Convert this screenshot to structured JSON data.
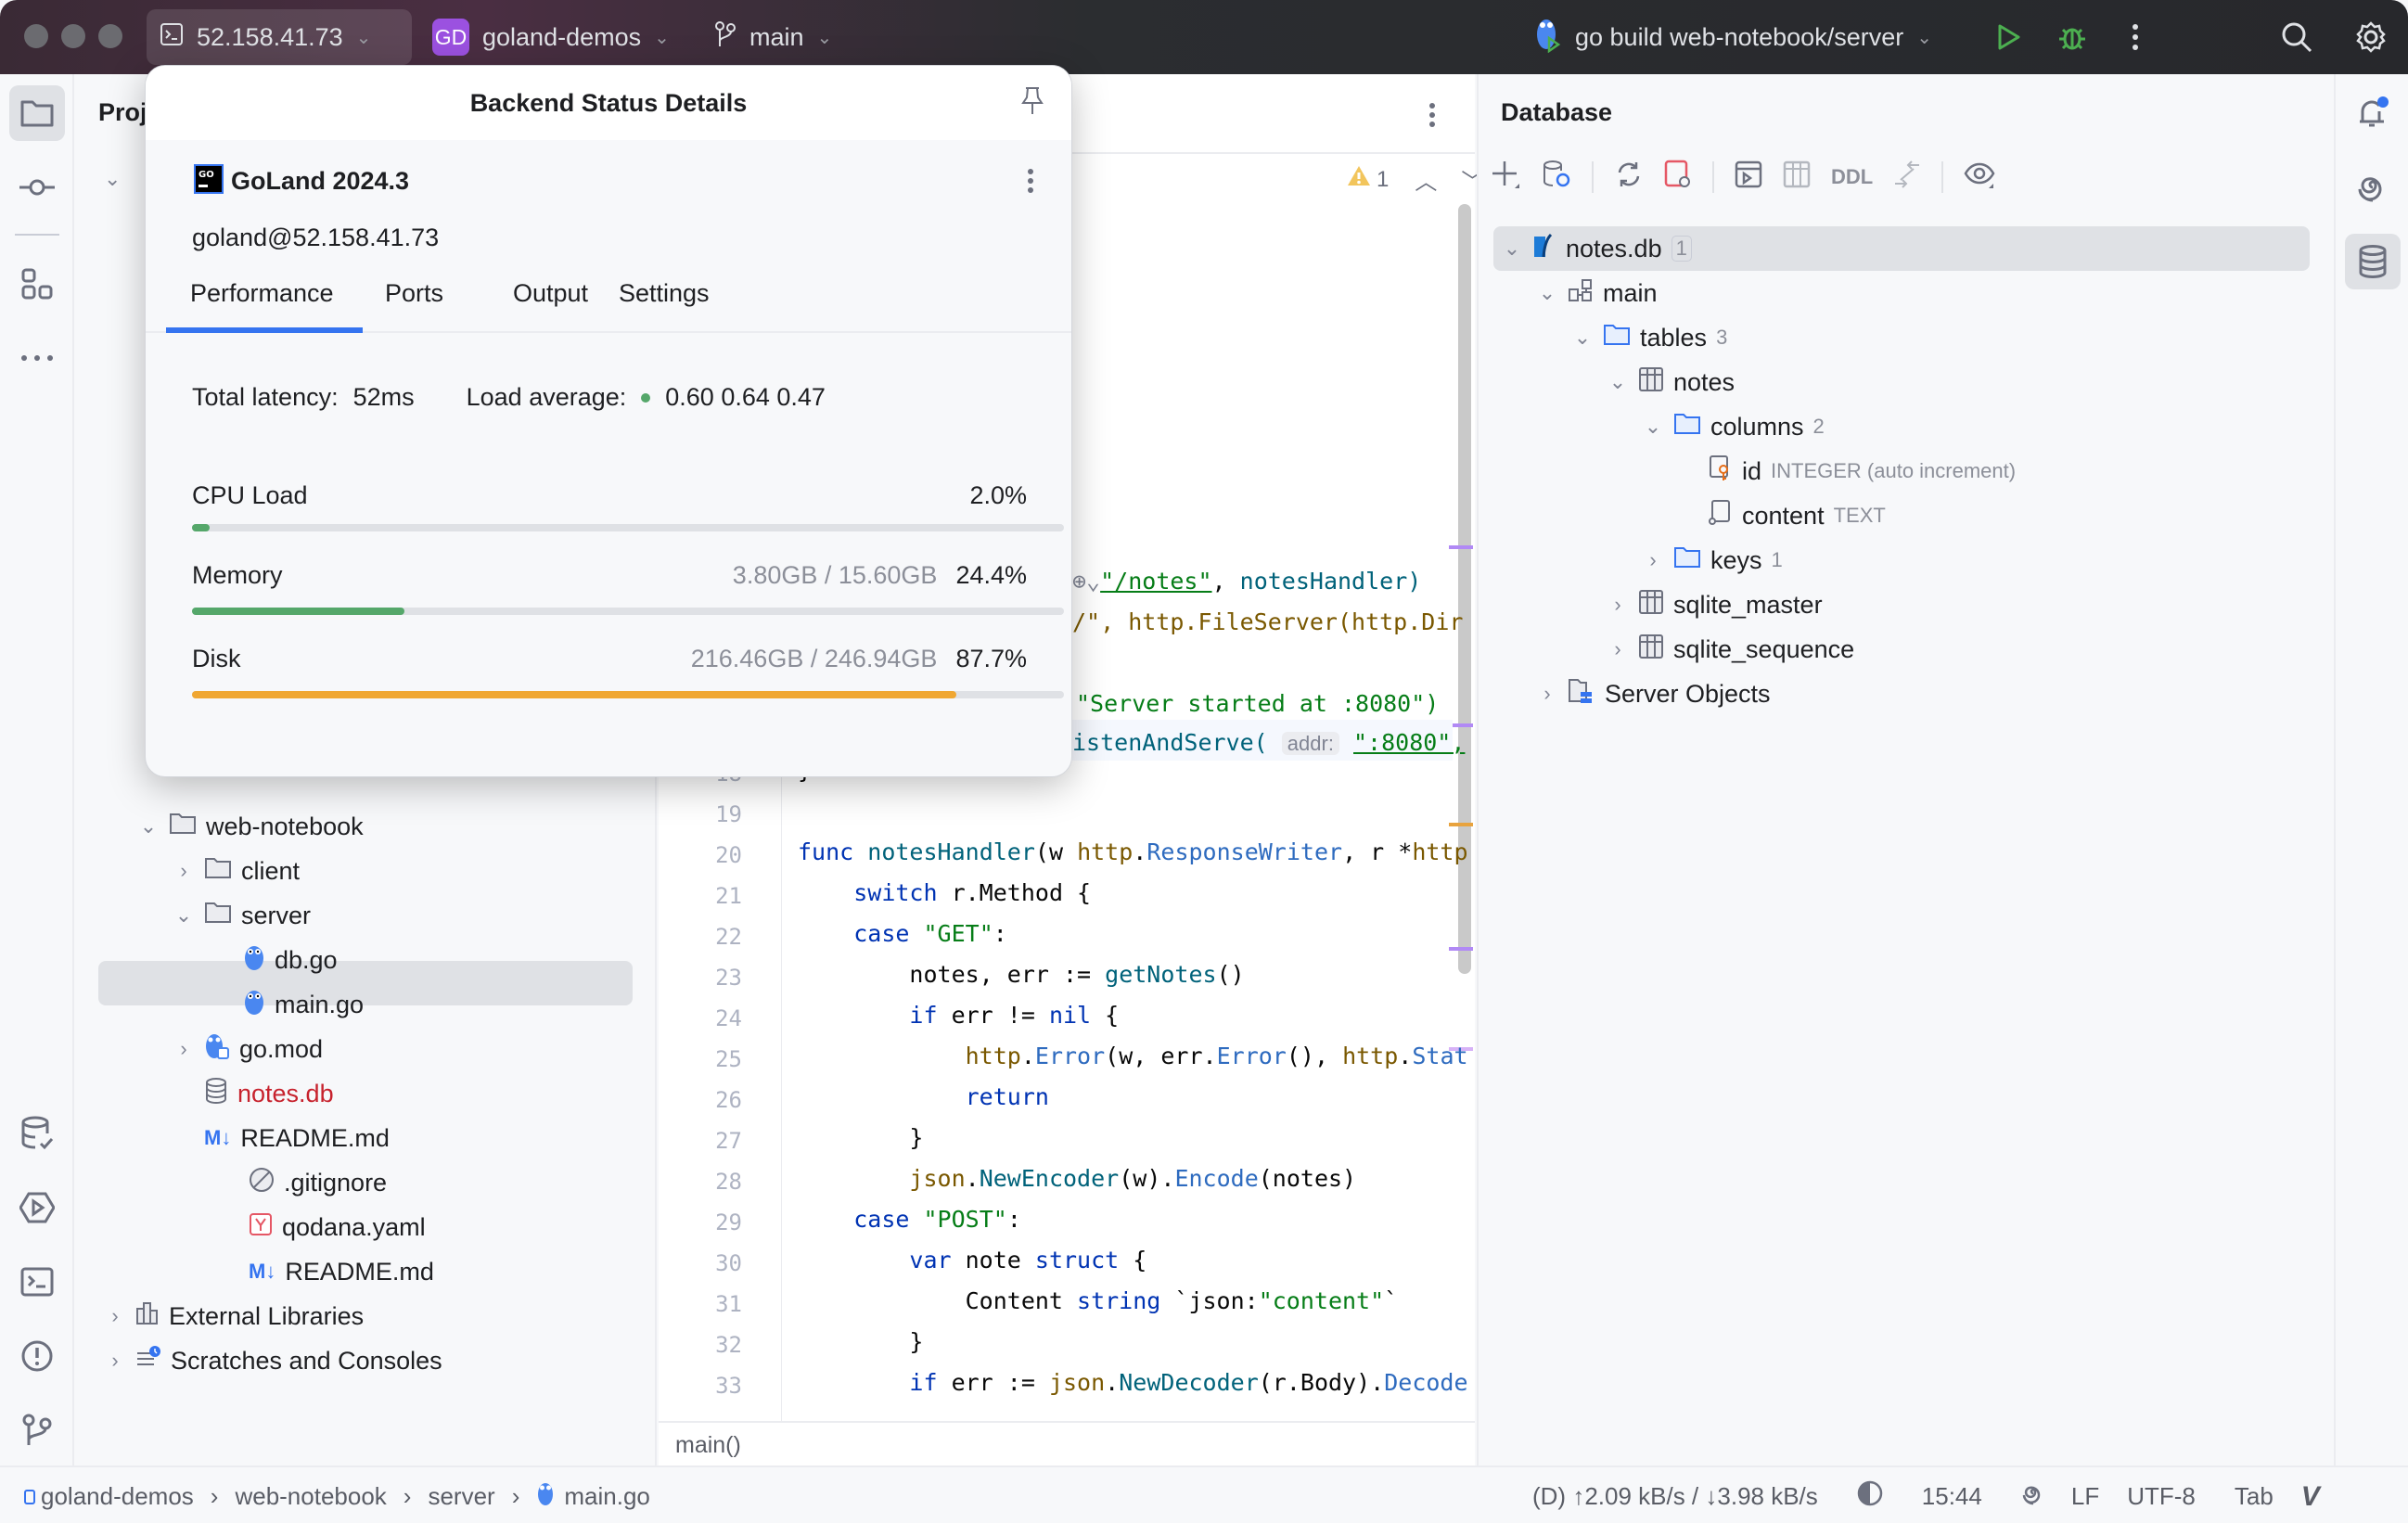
{
  "titlebar": {
    "remote_host": "52.158.41.73",
    "project_badge": "GD",
    "project_name": "goland-demos",
    "branch": "main",
    "run_config": "go build web-notebook/server",
    "colors": {
      "project_badge": "#9b51e0",
      "run": "#4caf50",
      "debug": "#4caf50"
    }
  },
  "left_toolbar": {
    "items": [
      "project-folder",
      "commit",
      "structure",
      "more",
      "database-changes",
      "services",
      "terminal",
      "problems",
      "git"
    ]
  },
  "project_panel": {
    "title": "Proj",
    "tree": [
      {
        "label": "web-notebook",
        "type": "folder",
        "expanded": true
      },
      {
        "label": "client",
        "type": "folder",
        "expanded": false
      },
      {
        "label": "server",
        "type": "folder",
        "expanded": true
      },
      {
        "label": "db.go",
        "type": "go-file"
      },
      {
        "label": "main.go",
        "type": "go-file",
        "selected": true
      },
      {
        "label": "go.mod",
        "type": "go-mod",
        "expanded": false
      },
      {
        "label": "notes.db",
        "type": "db-file",
        "color": "#c7222d"
      },
      {
        "label": "README.md",
        "type": "markdown"
      },
      {
        "label": ".gitignore",
        "type": "ignore"
      },
      {
        "label": "qodana.yaml",
        "type": "yaml"
      },
      {
        "label": "README.md",
        "type": "markdown"
      },
      {
        "label": "External Libraries",
        "type": "libraries",
        "expanded": false
      },
      {
        "label": "Scratches and Consoles",
        "type": "scratches",
        "expanded": false
      }
    ]
  },
  "popup": {
    "title": "Backend Status Details",
    "product": "GoLand 2024.3",
    "user_host": "goland@52.158.41.73",
    "tabs": [
      "Performance",
      "Ports",
      "Output",
      "Settings"
    ],
    "active_tab": "Performance",
    "latency_label": "Total latency:",
    "latency_value": "52ms",
    "load_label": "Load average:",
    "load_value": "0.60 0.64 0.47",
    "cpu": {
      "label": "CPU Load",
      "detail": "",
      "percent_text": "2.0%",
      "percent": 2.0,
      "color": "#55a76a"
    },
    "memory": {
      "label": "Memory",
      "detail": "3.80GB / 15.60GB",
      "percent_text": "24.4%",
      "percent": 24.4,
      "color": "#55a76a"
    },
    "disk": {
      "label": "Disk",
      "detail": "216.46GB / 246.94GB",
      "percent_text": "87.7%",
      "percent": 87.7,
      "color": "#f0a732"
    }
  },
  "editor": {
    "warnings_count": "1",
    "breadcrumb_fn": "main()",
    "lines": [
      {
        "n": "18",
        "text": "}"
      },
      {
        "n": "19",
        "text": ""
      },
      {
        "n": "20",
        "text": "func notesHandler(w http.ResponseWriter, r *http"
      },
      {
        "n": "21",
        "text": "    switch r.Method {"
      },
      {
        "n": "22",
        "text": "    case \"GET\":"
      },
      {
        "n": "23",
        "text": "        notes, err := getNotes()"
      },
      {
        "n": "24",
        "text": "        if err != nil {"
      },
      {
        "n": "25",
        "text": "            http.Error(w, err.Error(), http.Stat"
      },
      {
        "n": "26",
        "text": "            return"
      },
      {
        "n": "27",
        "text": "        }"
      },
      {
        "n": "28",
        "text": "        json.NewEncoder(w).Encode(notes)"
      },
      {
        "n": "29",
        "text": "    case \"POST\":"
      },
      {
        "n": "30",
        "text": "        var note struct {"
      },
      {
        "n": "31",
        "text": "            Content string `json:\"content\"`"
      },
      {
        "n": "32",
        "text": "        }"
      },
      {
        "n": "33",
        "text": "        if err := json.NewDecoder(r.Body).Decode"
      }
    ],
    "partial_lines": {
      "l1_route": "\"/notes\"",
      "l1_handler": "notesHandler)",
      "l2": "/\", http.FileServer(http.Dir",
      "l3": "\"Server started at :8080\")",
      "l4_prefix": "istenAndServe(",
      "l4_inlay": "addr:",
      "l4_value": "\":8080\","
    }
  },
  "database": {
    "title": "Database",
    "toolbar_ddl": "DDL",
    "tree": [
      {
        "label": "notes.db",
        "count": "1",
        "type": "sqlite",
        "expanded": true,
        "selected": true
      },
      {
        "label": "main",
        "type": "schema",
        "expanded": true
      },
      {
        "label": "tables",
        "count": "3",
        "type": "folder",
        "expanded": true
      },
      {
        "label": "notes",
        "type": "table",
        "expanded": true
      },
      {
        "label": "columns",
        "count": "2",
        "type": "folder",
        "expanded": true
      },
      {
        "label": "id",
        "detail": "INTEGER (auto increment)",
        "type": "pk-column"
      },
      {
        "label": "content",
        "detail": "TEXT",
        "type": "column"
      },
      {
        "label": "keys",
        "count": "1",
        "type": "folder",
        "expanded": false
      },
      {
        "label": "sqlite_master",
        "type": "table",
        "expanded": false
      },
      {
        "label": "sqlite_sequence",
        "type": "table",
        "expanded": false
      },
      {
        "label": "Server Objects",
        "type": "server-objects",
        "expanded": false
      }
    ]
  },
  "statusbar": {
    "breadcrumb": [
      "goland-demos",
      "web-notebook",
      "server",
      "main.go"
    ],
    "network": "(D) ↑2.09 kB/s / ↓3.98 kB/s",
    "time": "15:44",
    "line_sep": "LF",
    "encoding": "UTF-8",
    "indent": "Tab"
  }
}
